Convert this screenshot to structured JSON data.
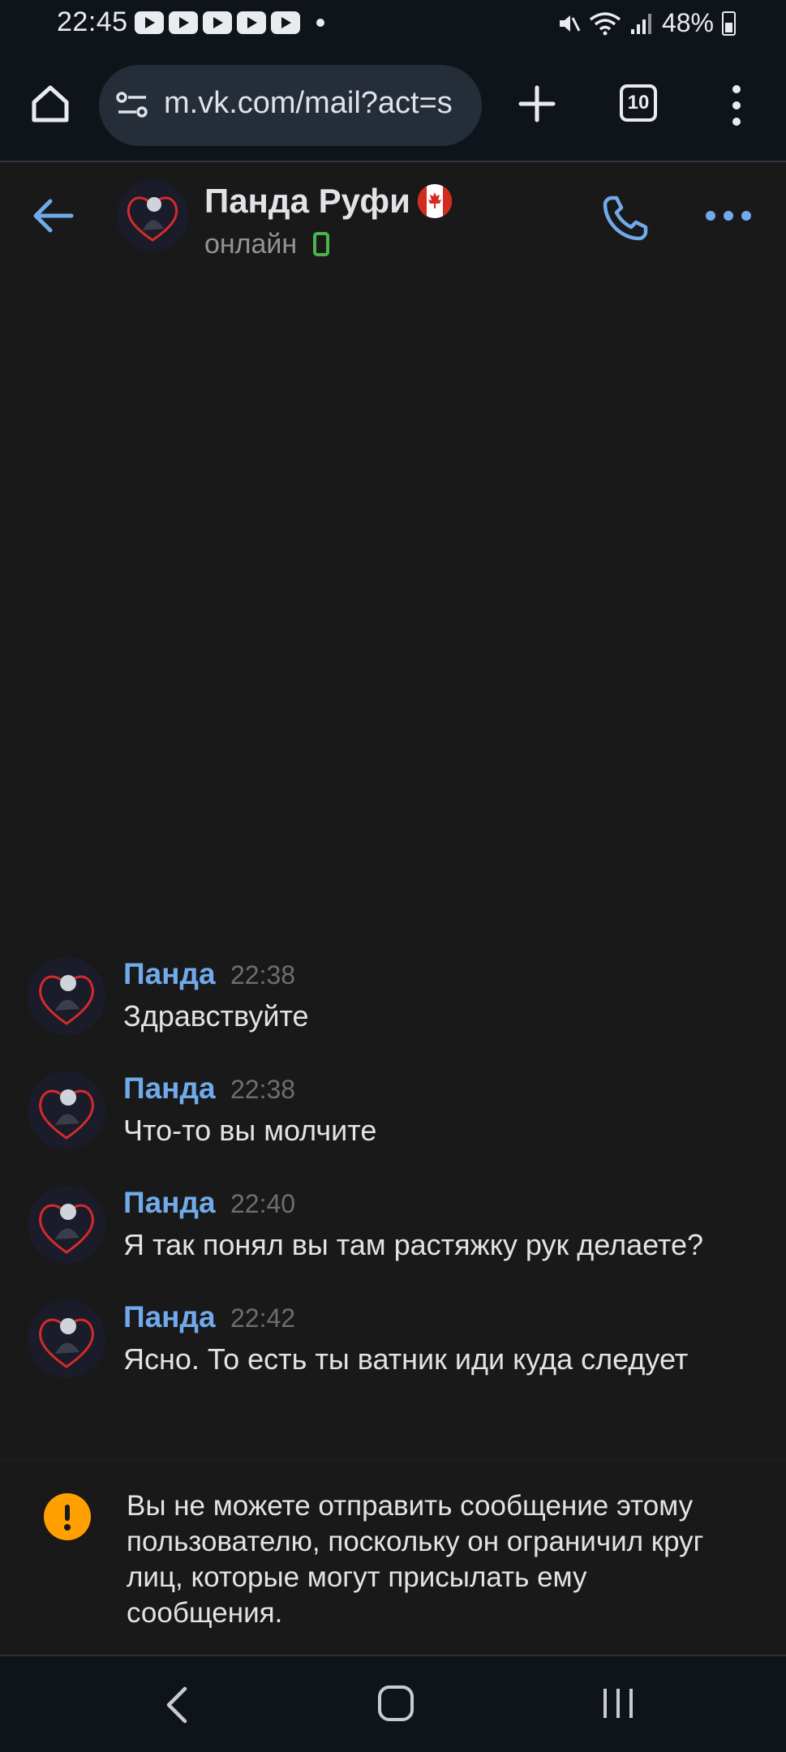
{
  "status_bar": {
    "time": "22:45",
    "battery": "48%"
  },
  "browser": {
    "url": "m.vk.com/mail?act=s",
    "tab_count": "10"
  },
  "chat": {
    "contact_name": "Панда Руфи",
    "status": "онлайн"
  },
  "messages": [
    {
      "author": "Панда",
      "time": "22:38",
      "text": "Здравствуйте"
    },
    {
      "author": "Панда",
      "time": "22:38",
      "text": "Что-то вы молчите"
    },
    {
      "author": "Панда",
      "time": "22:40",
      "text": "Я так понял вы там растяжку рук делаете?"
    },
    {
      "author": "Панда",
      "time": "22:42",
      "text": "Ясно. То есть ты ватник иди куда следует"
    }
  ],
  "notice": {
    "text": "Вы не можете отправить сообщение этому пользователю, поскольку он ограничил круг лиц, которые могут присылать ему сообщения."
  },
  "colors": {
    "accent": "#71aaeb",
    "warning": "#ffa000",
    "online": "#4bb34b",
    "background": "#191919"
  }
}
